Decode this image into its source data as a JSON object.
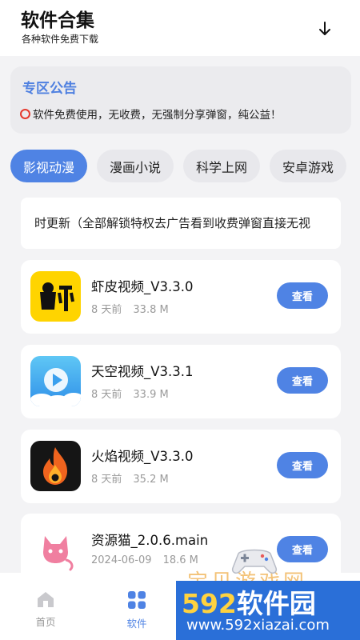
{
  "header": {
    "title": "软件合集",
    "subtitle": "各种软件免费下载",
    "download_icon": "download-arrow-icon"
  },
  "notice": {
    "title": "专区公告",
    "body": "软件免费使用，无收费，无强制分享弹窗，纯公益！",
    "marker_icon": "red-circle-icon"
  },
  "tabs": [
    {
      "label": "影视动漫",
      "active": true
    },
    {
      "label": "漫画小说",
      "active": false
    },
    {
      "label": "科学上网",
      "active": false
    },
    {
      "label": "安卓游戏",
      "active": false
    }
  ],
  "marquee": {
    "text": "时更新（全部解锁特权去广告看到收费弹窗直接无视"
  },
  "apps": [
    {
      "name": "虾皮视频_V3.3.0",
      "date": "8 天前",
      "size": "33.8 M",
      "button": "查看",
      "icon": "shrimp-video-icon"
    },
    {
      "name": "天空视频_V3.3.1",
      "date": "8 天前",
      "size": "33.9 M",
      "button": "查看",
      "icon": "sky-video-icon"
    },
    {
      "name": "火焰视频_V3.3.0",
      "date": "8 天前",
      "size": "35.2 M",
      "button": "查看",
      "icon": "flame-video-icon"
    },
    {
      "name": "资源猫_2.0.6.main",
      "date": "2024-06-09",
      "size": "18.6 M",
      "button": "查看",
      "icon": "cat-icon"
    }
  ],
  "bottom_nav": [
    {
      "label": "首页",
      "icon": "home-icon",
      "active": false
    },
    {
      "label": "软件",
      "icon": "apps-grid-icon",
      "active": true
    }
  ],
  "watermark": {
    "number": "592",
    "brand": "软件园",
    "url": "www.592xiazai.com",
    "faint_text": "宝贝游戏网"
  },
  "colors": {
    "accent": "#4f83e4",
    "notice_title": "#4f80e0",
    "background": "#f3f3f5",
    "card": "#ffffff",
    "muted_text": "#9a9a9a",
    "watermark_blue": "#2a6fd8",
    "watermark_yellow": "#ffd23f"
  }
}
